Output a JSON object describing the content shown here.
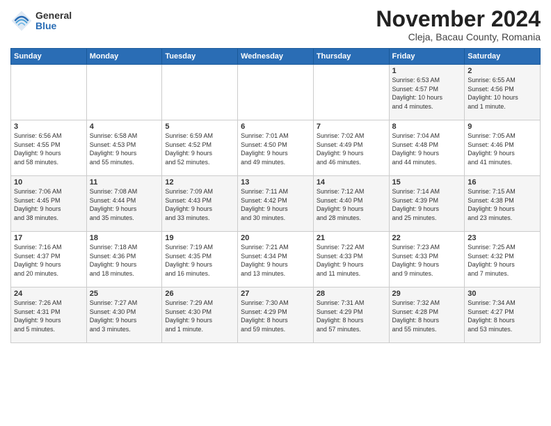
{
  "logo": {
    "general": "General",
    "blue": "Blue"
  },
  "title": "November 2024",
  "location": "Cleja, Bacau County, Romania",
  "days_header": [
    "Sunday",
    "Monday",
    "Tuesday",
    "Wednesday",
    "Thursday",
    "Friday",
    "Saturday"
  ],
  "weeks": [
    [
      {
        "day": "",
        "info": ""
      },
      {
        "day": "",
        "info": ""
      },
      {
        "day": "",
        "info": ""
      },
      {
        "day": "",
        "info": ""
      },
      {
        "day": "",
        "info": ""
      },
      {
        "day": "1",
        "info": "Sunrise: 6:53 AM\nSunset: 4:57 PM\nDaylight: 10 hours\nand 4 minutes."
      },
      {
        "day": "2",
        "info": "Sunrise: 6:55 AM\nSunset: 4:56 PM\nDaylight: 10 hours\nand 1 minute."
      }
    ],
    [
      {
        "day": "3",
        "info": "Sunrise: 6:56 AM\nSunset: 4:55 PM\nDaylight: 9 hours\nand 58 minutes."
      },
      {
        "day": "4",
        "info": "Sunrise: 6:58 AM\nSunset: 4:53 PM\nDaylight: 9 hours\nand 55 minutes."
      },
      {
        "day": "5",
        "info": "Sunrise: 6:59 AM\nSunset: 4:52 PM\nDaylight: 9 hours\nand 52 minutes."
      },
      {
        "day": "6",
        "info": "Sunrise: 7:01 AM\nSunset: 4:50 PM\nDaylight: 9 hours\nand 49 minutes."
      },
      {
        "day": "7",
        "info": "Sunrise: 7:02 AM\nSunset: 4:49 PM\nDaylight: 9 hours\nand 46 minutes."
      },
      {
        "day": "8",
        "info": "Sunrise: 7:04 AM\nSunset: 4:48 PM\nDaylight: 9 hours\nand 44 minutes."
      },
      {
        "day": "9",
        "info": "Sunrise: 7:05 AM\nSunset: 4:46 PM\nDaylight: 9 hours\nand 41 minutes."
      }
    ],
    [
      {
        "day": "10",
        "info": "Sunrise: 7:06 AM\nSunset: 4:45 PM\nDaylight: 9 hours\nand 38 minutes."
      },
      {
        "day": "11",
        "info": "Sunrise: 7:08 AM\nSunset: 4:44 PM\nDaylight: 9 hours\nand 35 minutes."
      },
      {
        "day": "12",
        "info": "Sunrise: 7:09 AM\nSunset: 4:43 PM\nDaylight: 9 hours\nand 33 minutes."
      },
      {
        "day": "13",
        "info": "Sunrise: 7:11 AM\nSunset: 4:42 PM\nDaylight: 9 hours\nand 30 minutes."
      },
      {
        "day": "14",
        "info": "Sunrise: 7:12 AM\nSunset: 4:40 PM\nDaylight: 9 hours\nand 28 minutes."
      },
      {
        "day": "15",
        "info": "Sunrise: 7:14 AM\nSunset: 4:39 PM\nDaylight: 9 hours\nand 25 minutes."
      },
      {
        "day": "16",
        "info": "Sunrise: 7:15 AM\nSunset: 4:38 PM\nDaylight: 9 hours\nand 23 minutes."
      }
    ],
    [
      {
        "day": "17",
        "info": "Sunrise: 7:16 AM\nSunset: 4:37 PM\nDaylight: 9 hours\nand 20 minutes."
      },
      {
        "day": "18",
        "info": "Sunrise: 7:18 AM\nSunset: 4:36 PM\nDaylight: 9 hours\nand 18 minutes."
      },
      {
        "day": "19",
        "info": "Sunrise: 7:19 AM\nSunset: 4:35 PM\nDaylight: 9 hours\nand 16 minutes."
      },
      {
        "day": "20",
        "info": "Sunrise: 7:21 AM\nSunset: 4:34 PM\nDaylight: 9 hours\nand 13 minutes."
      },
      {
        "day": "21",
        "info": "Sunrise: 7:22 AM\nSunset: 4:33 PM\nDaylight: 9 hours\nand 11 minutes."
      },
      {
        "day": "22",
        "info": "Sunrise: 7:23 AM\nSunset: 4:33 PM\nDaylight: 9 hours\nand 9 minutes."
      },
      {
        "day": "23",
        "info": "Sunrise: 7:25 AM\nSunset: 4:32 PM\nDaylight: 9 hours\nand 7 minutes."
      }
    ],
    [
      {
        "day": "24",
        "info": "Sunrise: 7:26 AM\nSunset: 4:31 PM\nDaylight: 9 hours\nand 5 minutes."
      },
      {
        "day": "25",
        "info": "Sunrise: 7:27 AM\nSunset: 4:30 PM\nDaylight: 9 hours\nand 3 minutes."
      },
      {
        "day": "26",
        "info": "Sunrise: 7:29 AM\nSunset: 4:30 PM\nDaylight: 9 hours\nand 1 minute."
      },
      {
        "day": "27",
        "info": "Sunrise: 7:30 AM\nSunset: 4:29 PM\nDaylight: 8 hours\nand 59 minutes."
      },
      {
        "day": "28",
        "info": "Sunrise: 7:31 AM\nSunset: 4:29 PM\nDaylight: 8 hours\nand 57 minutes."
      },
      {
        "day": "29",
        "info": "Sunrise: 7:32 AM\nSunset: 4:28 PM\nDaylight: 8 hours\nand 55 minutes."
      },
      {
        "day": "30",
        "info": "Sunrise: 7:34 AM\nSunset: 4:27 PM\nDaylight: 8 hours\nand 53 minutes."
      }
    ]
  ]
}
